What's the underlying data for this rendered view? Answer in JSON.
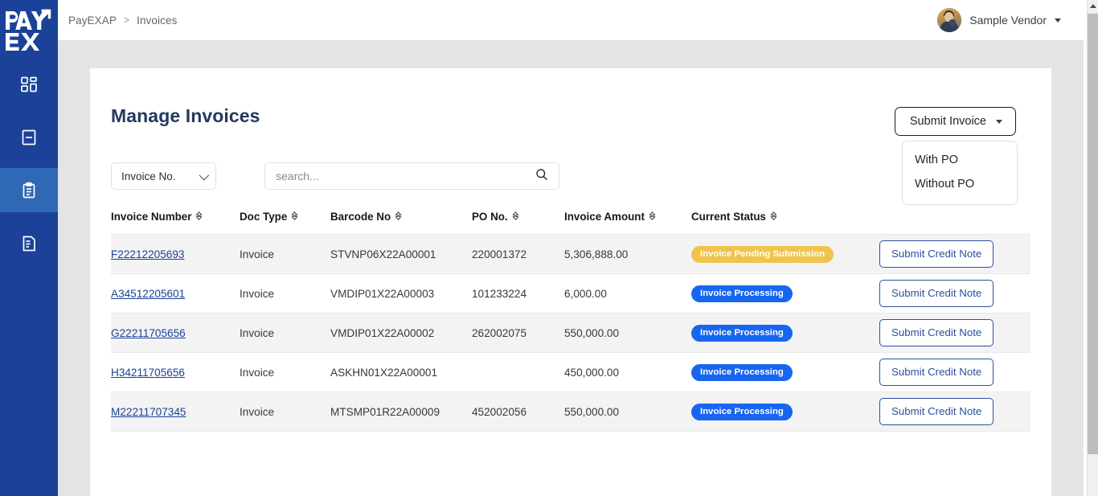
{
  "brand": {
    "logo_line1": "PAY",
    "logo_line2": "EX",
    "sidebar_color": "#1b4298",
    "active_item_color": "#2f68b5"
  },
  "sidebar": {
    "items": [
      {
        "name": "dashboard",
        "icon": "grid-dashboard-icon",
        "active": false
      },
      {
        "name": "documents",
        "icon": "document-icon",
        "active": false
      },
      {
        "name": "invoices",
        "icon": "clipboard-icon",
        "active": true
      },
      {
        "name": "reports",
        "icon": "file-text-icon",
        "active": false
      }
    ]
  },
  "header": {
    "breadcrumb": [
      "PayEXAP",
      "Invoices"
    ],
    "breadcrumb_separator": ">",
    "user_name": "Sample Vendor",
    "avatar_icon": "user-avatar-photo",
    "caret_icon": "caret-down-icon"
  },
  "main": {
    "page_title": "Manage Invoices",
    "submit_invoice": {
      "label": "Submit Invoice",
      "caret_icon": "caret-down-icon",
      "open": true,
      "options": [
        "With PO",
        "Without PO"
      ]
    },
    "filters": {
      "select_value": "Invoice No.",
      "select_chevron_icon": "chevron-down-icon",
      "search_placeholder": "search...",
      "search_value": "",
      "search_icon": "search-icon"
    },
    "table": {
      "columns": [
        {
          "label": "Invoice Number",
          "sortable": true
        },
        {
          "label": "Doc Type",
          "sortable": true
        },
        {
          "label": "Barcode No",
          "sortable": true
        },
        {
          "label": "PO No.",
          "sortable": true
        },
        {
          "label": "Invoice Amount",
          "sortable": true
        },
        {
          "label": "Current Status",
          "sortable": true
        },
        {
          "label": "",
          "sortable": false
        }
      ],
      "sort_icon": "sort-updown-icon",
      "row_action_label": "Submit Credit Note",
      "rows": [
        {
          "invoice_number": "F22212205693",
          "doc_type": "Invoice",
          "barcode_no": "STVNP06X22A00001",
          "po_no": "220001372",
          "invoice_amount": "5,306,888.00",
          "status": "Invoice Pending Submission",
          "status_color": "#f0c44c",
          "action": "Submit Credit Note"
        },
        {
          "invoice_number": "A34512205601",
          "doc_type": "Invoice",
          "barcode_no": "VMDIP01X22A00003",
          "po_no": "101233224",
          "invoice_amount": "6,000.00",
          "status": "Invoice Processing",
          "status_color": "#1866ef",
          "action": "Submit Credit Note"
        },
        {
          "invoice_number": "G22211705656",
          "doc_type": "Invoice",
          "barcode_no": "VMDIP01X22A00002",
          "po_no": "262002075",
          "invoice_amount": "550,000.00",
          "status": "Invoice Processing",
          "status_color": "#1866ef",
          "action": "Submit Credit Note"
        },
        {
          "invoice_number": "H34211705656",
          "doc_type": "Invoice",
          "barcode_no": "ASKHN01X22A00001",
          "po_no": "",
          "invoice_amount": "450,000.00",
          "status": "Invoice Processing",
          "status_color": "#1866ef",
          "action": "Submit Credit Note"
        },
        {
          "invoice_number": "M22211707345",
          "doc_type": "Invoice",
          "barcode_no": "MTSMP01R22A00009",
          "po_no": "452002056",
          "invoice_amount": "550,000.00",
          "status": "Invoice Processing",
          "status_color": "#1866ef",
          "action": "Submit Credit Note"
        }
      ]
    }
  },
  "scrollbar": {
    "up_arrow_icon": "scroll-up-arrow-icon",
    "thumb_icon": "scrollbar-thumb"
  }
}
